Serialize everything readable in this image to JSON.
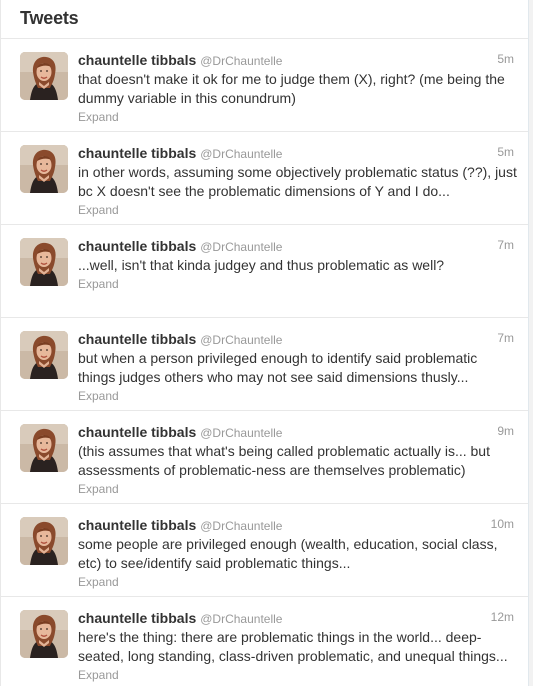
{
  "header": {
    "title": "Tweets"
  },
  "tweets": [
    {
      "fullname": "chauntelle tibbals",
      "username": "@DrChauntelle",
      "time": "5m",
      "text": "that doesn't make it ok for me to judge them (X), right? (me being the dummy variable in this conundrum)",
      "expand": "Expand"
    },
    {
      "fullname": "chauntelle tibbals",
      "username": "@DrChauntelle",
      "time": "5m",
      "text": "in other words, assuming some objectively problematic status (??), just bc X doesn't see the problematic dimensions of Y and I do...",
      "expand": "Expand"
    },
    {
      "fullname": "chauntelle tibbals",
      "username": "@DrChauntelle",
      "time": "7m",
      "text": "...well, isn't that kinda judgey and thus problematic as well?",
      "expand": "Expand"
    },
    {
      "fullname": "chauntelle tibbals",
      "username": "@DrChauntelle",
      "time": "7m",
      "text": "but when a person privileged enough to identify said problematic things judges others who may not see said dimensions thusly...",
      "expand": "Expand"
    },
    {
      "fullname": "chauntelle tibbals",
      "username": "@DrChauntelle",
      "time": "9m",
      "text": "(this assumes that what's being called problematic actually is... but assessments of problematic-ness are themselves problematic)",
      "expand": "Expand"
    },
    {
      "fullname": "chauntelle tibbals",
      "username": "@DrChauntelle",
      "time": "10m",
      "text": "some people are privileged enough (wealth, education, social class, etc) to see/identify said problematic things...",
      "expand": "Expand"
    },
    {
      "fullname": "chauntelle tibbals",
      "username": "@DrChauntelle",
      "time": "12m",
      "text": "here's the thing: there are problematic things in the world... deep-seated, long standing, class-driven problematic, and unequal things...",
      "expand": "Expand"
    }
  ]
}
